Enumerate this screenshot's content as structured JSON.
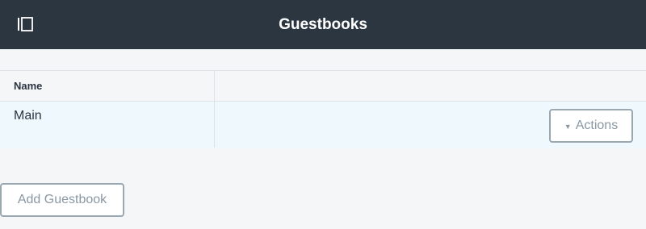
{
  "header": {
    "title": "Guestbooks",
    "menu_icon": "sidebar-toggle-icon"
  },
  "table": {
    "columns": [
      "Name",
      ""
    ],
    "rows": [
      {
        "name": "Main",
        "actions_label": "Actions",
        "actions_icon": "caret-down-icon"
      }
    ]
  },
  "footer": {
    "add_label": "Add Guestbook"
  },
  "colors": {
    "topbar": "#2c3640",
    "row_highlight": "#eff8fd",
    "border": "#dde2e6",
    "button_border": "#9aa8b2",
    "button_text": "#8a98a3"
  }
}
